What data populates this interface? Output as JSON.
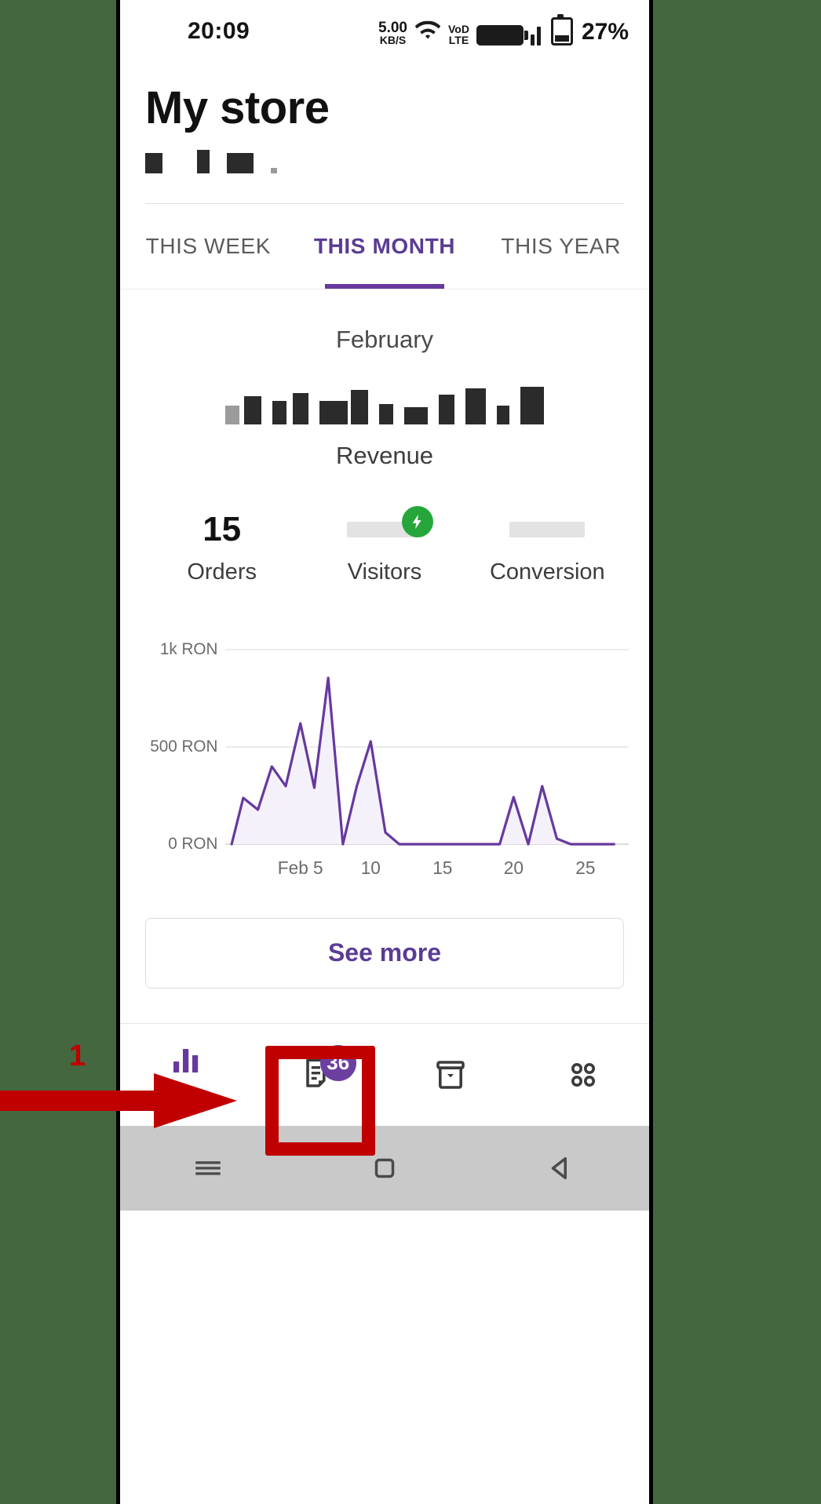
{
  "statusbar": {
    "time": "20:09",
    "net_speed_value": "5.00",
    "net_speed_unit": "KB/S",
    "wifi_icon": "wifi-icon",
    "volte_top": "VoD",
    "volte_bottom": "LTE",
    "battery_percent": "27%"
  },
  "header": {
    "title": "My store"
  },
  "tabs": [
    {
      "label": "THIS WEEK",
      "active": false
    },
    {
      "label": "THIS MONTH",
      "active": true
    },
    {
      "label": "THIS YEAR",
      "active": false
    }
  ],
  "summary": {
    "month": "February",
    "revenue_label": "Revenue",
    "revenue_value_redacted": true,
    "stats": [
      {
        "value": "15",
        "label": "Orders",
        "redacted": false,
        "badge": null
      },
      {
        "value": "",
        "label": "Visitors",
        "redacted": true,
        "badge": "bolt-icon"
      },
      {
        "value": "",
        "label": "Conversion",
        "redacted": true,
        "badge": null
      }
    ]
  },
  "chart_data": {
    "type": "line",
    "title": "",
    "xlabel": "",
    "ylabel": "",
    "currency": "RON",
    "ytick_labels": [
      "0 RON",
      "500 RON",
      "1k RON"
    ],
    "ytick_values": [
      0,
      500,
      1000
    ],
    "ylim": [
      0,
      1050
    ],
    "xtick_labels": [
      "Feb 5",
      "10",
      "15",
      "20",
      "25"
    ],
    "xtick_values": [
      5,
      10,
      15,
      20,
      25
    ],
    "xlim": [
      1,
      28
    ],
    "grid": true,
    "legend": "none",
    "line_color": "#66399e",
    "fill_color": "#f4f0f9",
    "x": [
      1,
      2,
      3,
      4,
      5,
      6,
      7,
      8,
      9,
      10,
      11,
      12,
      13,
      14,
      15,
      16,
      17,
      18,
      19,
      20,
      21,
      22,
      23,
      24,
      25,
      26,
      27,
      28
    ],
    "values": [
      0,
      240,
      180,
      400,
      300,
      620,
      290,
      940,
      0,
      300,
      530,
      60,
      0,
      0,
      0,
      0,
      0,
      0,
      0,
      0,
      240,
      0,
      300,
      30,
      0,
      0,
      0,
      0
    ]
  },
  "see_more": {
    "label": "See more"
  },
  "bottomnav": [
    {
      "icon": "bar-chart-icon",
      "label": "My store",
      "badge": null,
      "active": true
    },
    {
      "icon": "document-icon",
      "label": "",
      "badge": "36",
      "active": false
    },
    {
      "icon": "archive-box-icon",
      "label": "",
      "badge": null,
      "active": false
    },
    {
      "icon": "grid-dots-icon",
      "label": "",
      "badge": null,
      "active": false
    }
  ],
  "androidbar": [
    {
      "icon": "menu-icon"
    },
    {
      "icon": "home-square-icon"
    },
    {
      "icon": "back-triangle-icon"
    }
  ],
  "annotation": {
    "step_number": "1",
    "color": "#c00000",
    "target": "document-tab"
  },
  "colors": {
    "accent_purple": "#66399e",
    "badge_purple": "#6b3fa0",
    "green": "#26a63a",
    "annotation_red": "#c00000",
    "page_background": "#44673f"
  }
}
